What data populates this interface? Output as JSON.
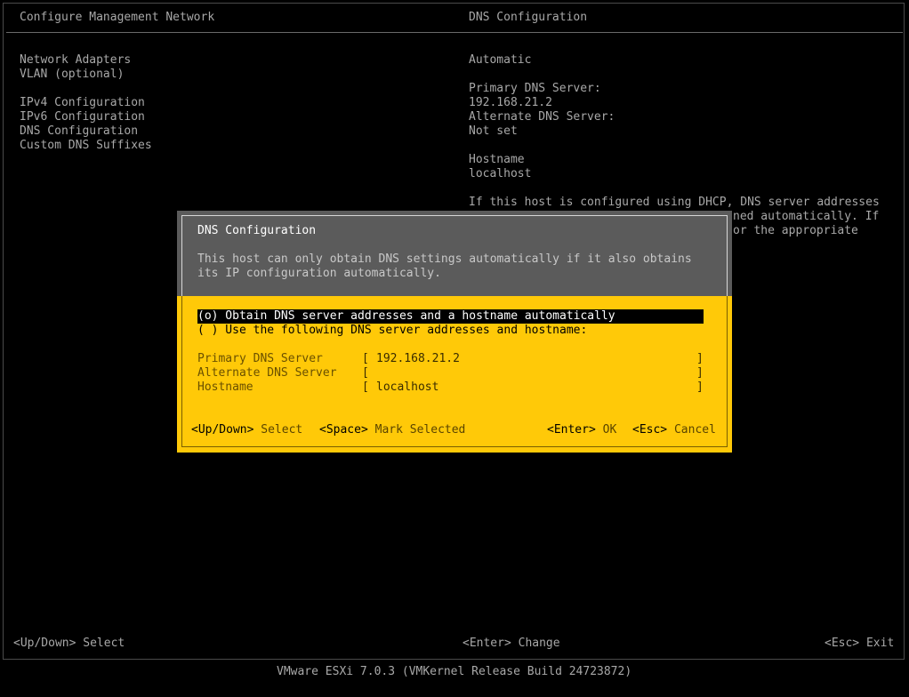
{
  "header": {
    "left_title": "Configure Management Network",
    "right_title": "DNS Configuration"
  },
  "menu": {
    "items": [
      "Network Adapters",
      "VLAN (optional)",
      "IPv4 Configuration",
      "IPv6 Configuration",
      "DNS Configuration",
      "Custom DNS Suffixes"
    ]
  },
  "info": {
    "mode": "Automatic",
    "primary_label": "Primary DNS Server:",
    "primary_value": "192.168.21.2",
    "alternate_label": "Alternate DNS Server:",
    "alternate_value": "Not set",
    "hostname_label": "Hostname",
    "hostname_value": "localhost",
    "note_line1": "If this host is configured using DHCP, DNS server addresses",
    "note_line2_tail": "ned automatically. If",
    "note_line3_tail": "or the appropriate"
  },
  "dialog": {
    "title": "DNS Configuration",
    "desc_line1": "This host can only obtain DNS settings automatically if it also obtains",
    "desc_line2": "its IP configuration automatically.",
    "option_auto": "(o) Obtain DNS server addresses and a hostname automatically",
    "option_manual": "( ) Use the following DNS server addresses and hostname:",
    "fields": {
      "primary_label": "Primary DNS Server",
      "primary_value": "192.168.21.2",
      "alternate_label": "Alternate DNS Server",
      "alternate_value": "",
      "hostname_label": "Hostname",
      "hostname_value": "localhost"
    },
    "hints": {
      "updown_key": "<Up/Down>",
      "updown_text": "Select",
      "space_key": "<Space>",
      "space_text": "Mark Selected",
      "enter_key": "<Enter>",
      "enter_text": "OK",
      "esc_key": "<Esc>",
      "esc_text": "Cancel"
    }
  },
  "bottom": {
    "updown_key": "<Up/Down>",
    "updown_text": "Select",
    "enter_key": "<Enter>",
    "enter_text": "Change",
    "esc_key": "<Esc>",
    "esc_text": "Exit"
  },
  "footer": {
    "build": "VMware ESXi 7.0.3 (VMKernel Release Build 24723872)"
  }
}
